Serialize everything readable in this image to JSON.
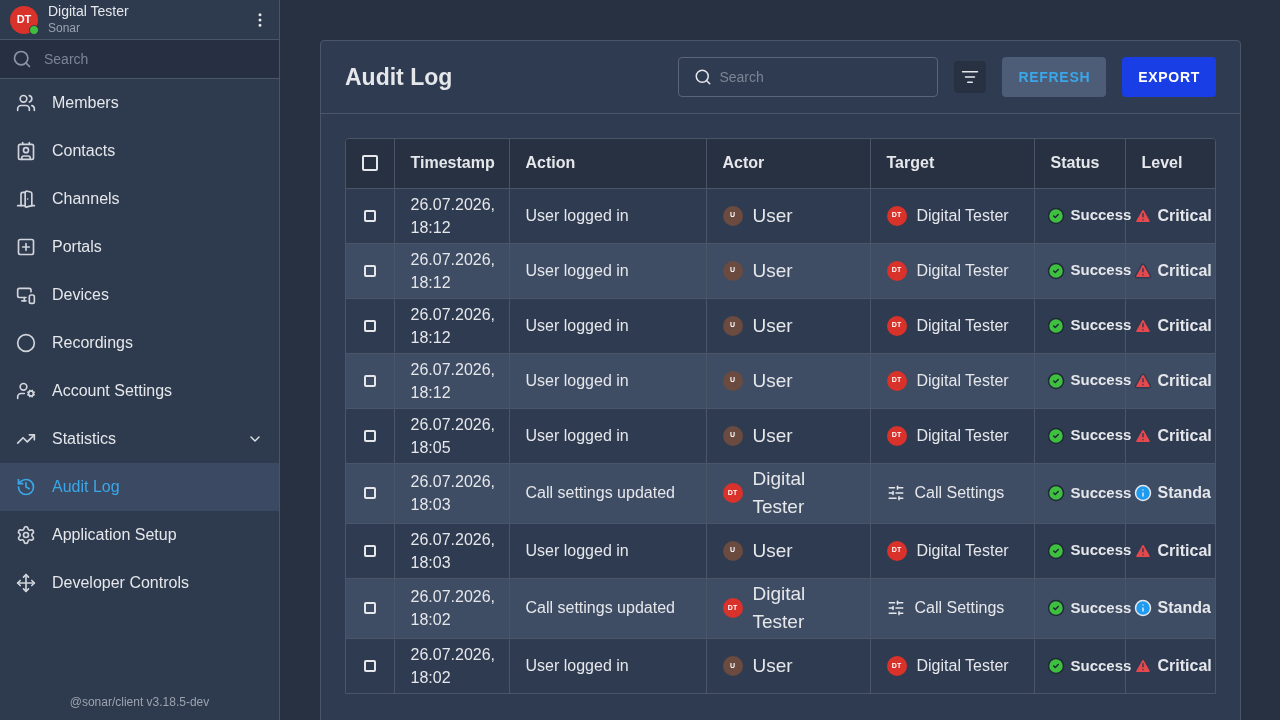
{
  "user": {
    "initials": "DT",
    "name": "Digital Tester",
    "org": "Sonar",
    "online": true
  },
  "sidebar_search": {
    "placeholder": "Search"
  },
  "sidebar": {
    "items": [
      {
        "label": "Members",
        "selected": false
      },
      {
        "label": "Contacts",
        "selected": false
      },
      {
        "label": "Channels",
        "selected": false
      },
      {
        "label": "Portals",
        "selected": false
      },
      {
        "label": "Devices",
        "selected": false
      },
      {
        "label": "Recordings",
        "selected": false
      },
      {
        "label": "Account Settings",
        "selected": false
      },
      {
        "label": "Statistics",
        "selected": false,
        "expanded": false
      },
      {
        "label": "Audit Log",
        "selected": true
      },
      {
        "label": "Application Setup",
        "selected": false
      },
      {
        "label": "Developer Controls",
        "selected": false
      }
    ]
  },
  "version": "@sonar/client v3.18.5-dev",
  "page": {
    "title": "Audit Log",
    "search": {
      "placeholder": "Search"
    },
    "buttons": [
      "REFRESH",
      "EXPORT"
    ]
  },
  "table": {
    "select_all": {
      "checked": false
    },
    "columns": [
      "Timestamp",
      "Action",
      "Actor",
      "Target",
      "Status",
      "Level"
    ],
    "rows": [
      {
        "checked": false,
        "timestamp": "26.07.2026, 18:12",
        "action": "User logged in",
        "actor": {
          "kind": "user",
          "initials": "U",
          "name": "User"
        },
        "target": {
          "kind": "user",
          "initials": "DT",
          "name": "Digital Tester"
        },
        "status": {
          "kind": "success",
          "label": "Success"
        },
        "level": {
          "kind": "critical",
          "label": "Critical"
        }
      },
      {
        "checked": false,
        "timestamp": "26.07.2026, 18:12",
        "action": "User logged in",
        "actor": {
          "kind": "user",
          "initials": "U",
          "name": "User"
        },
        "target": {
          "kind": "user",
          "initials": "DT",
          "name": "Digital Tester"
        },
        "status": {
          "kind": "success",
          "label": "Success"
        },
        "level": {
          "kind": "critical",
          "label": "Critical"
        }
      },
      {
        "checked": false,
        "timestamp": "26.07.2026, 18:12",
        "action": "User logged in",
        "actor": {
          "kind": "user",
          "initials": "U",
          "name": "User"
        },
        "target": {
          "kind": "user",
          "initials": "DT",
          "name": "Digital Tester"
        },
        "status": {
          "kind": "success",
          "label": "Success"
        },
        "level": {
          "kind": "critical",
          "label": "Critical"
        }
      },
      {
        "checked": false,
        "timestamp": "26.07.2026, 18:12",
        "action": "User logged in",
        "actor": {
          "kind": "user",
          "initials": "U",
          "name": "User"
        },
        "target": {
          "kind": "user",
          "initials": "DT",
          "name": "Digital Tester"
        },
        "status": {
          "kind": "success",
          "label": "Success"
        },
        "level": {
          "kind": "critical",
          "label": "Critical"
        }
      },
      {
        "checked": false,
        "timestamp": "26.07.2026, 18:05",
        "action": "User logged in",
        "actor": {
          "kind": "user",
          "initials": "U",
          "name": "User"
        },
        "target": {
          "kind": "user",
          "initials": "DT",
          "name": "Digital Tester"
        },
        "status": {
          "kind": "success",
          "label": "Success"
        },
        "level": {
          "kind": "critical",
          "label": "Critical"
        }
      },
      {
        "checked": false,
        "timestamp": "26.07.2026, 18:03",
        "action": "Call settings updated",
        "actor": {
          "kind": "admin",
          "initials": "DT",
          "name": "Digital Tester"
        },
        "target": {
          "kind": "settings",
          "name": "Call Settings"
        },
        "status": {
          "kind": "success",
          "label": "Success"
        },
        "level": {
          "kind": "standard",
          "label": "Standa"
        }
      },
      {
        "checked": false,
        "timestamp": "26.07.2026, 18:03",
        "action": "User logged in",
        "actor": {
          "kind": "user",
          "initials": "U",
          "name": "User"
        },
        "target": {
          "kind": "user",
          "initials": "DT",
          "name": "Digital Tester"
        },
        "status": {
          "kind": "success",
          "label": "Success"
        },
        "level": {
          "kind": "critical",
          "label": "Critical"
        }
      },
      {
        "checked": false,
        "timestamp": "26.07.2026, 18:02",
        "action": "Call settings updated",
        "actor": {
          "kind": "admin",
          "initials": "DT",
          "name": "Digital Tester"
        },
        "target": {
          "kind": "settings",
          "name": "Call Settings"
        },
        "status": {
          "kind": "success",
          "label": "Success"
        },
        "level": {
          "kind": "standard",
          "label": "Standa"
        }
      },
      {
        "checked": false,
        "timestamp": "26.07.2026, 18:02",
        "action": "User logged in",
        "actor": {
          "kind": "user",
          "initials": "U",
          "name": "User"
        },
        "target": {
          "kind": "user",
          "initials": "DT",
          "name": "Digital Tester"
        },
        "status": {
          "kind": "success",
          "label": "Success"
        },
        "level": {
          "kind": "critical",
          "label": "Critical"
        }
      }
    ]
  }
}
